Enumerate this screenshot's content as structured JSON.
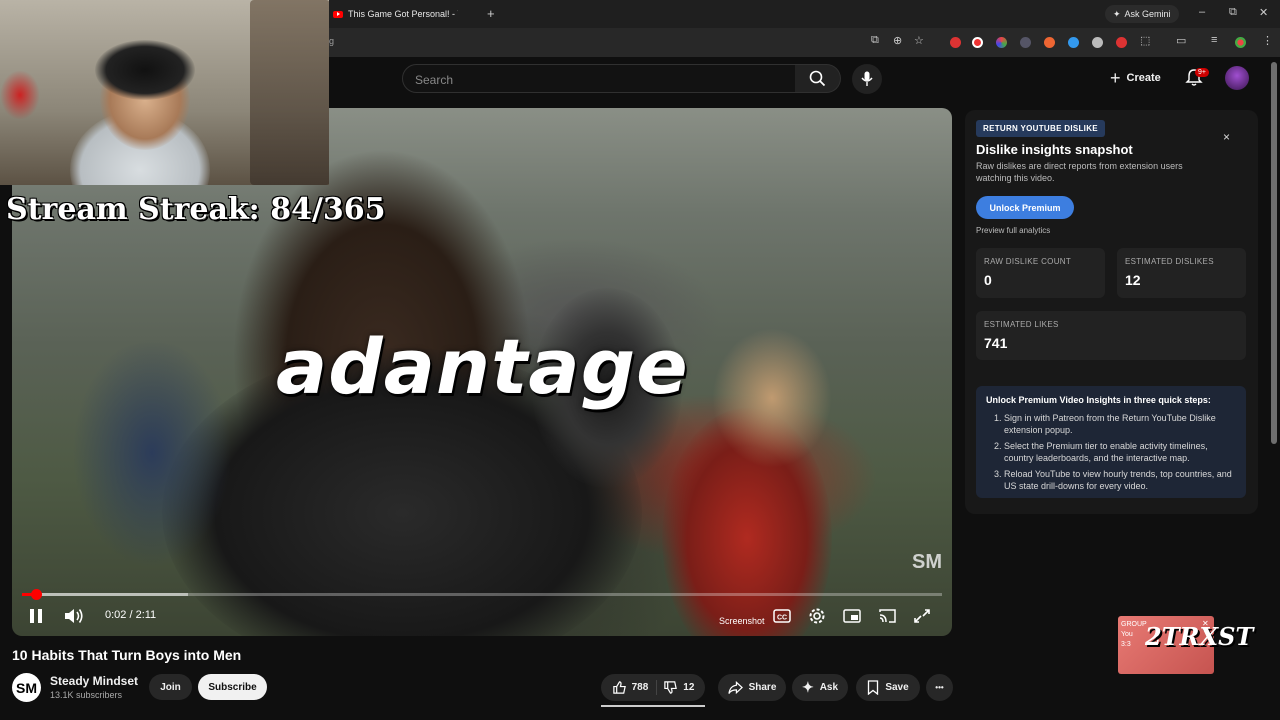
{
  "browser": {
    "tab_title": "This Game Got Personal! - YouTube",
    "url": "g",
    "ask_gemini": "Ask Gemini",
    "new_tab_symbol": "+",
    "minimize_symbol": "–",
    "restore_symbol": "⧉",
    "close_symbol": "✕"
  },
  "header": {
    "search_placeholder": "Search",
    "create_label": "Create",
    "notification_count": "9+"
  },
  "player": {
    "overlay_caption": "adantage",
    "watermark": "SM",
    "time_display": "0:02 / 2:11",
    "played_fraction": 0.015,
    "buffered_fraction": 0.18,
    "screenshot_label": "Screenshot"
  },
  "stream": {
    "streak_text": "Stream Streak: 84/365"
  },
  "panel": {
    "badge": "RETURN YOUTUBE DISLIKE",
    "title": "Dislike insights snapshot",
    "description": "Raw dislikes are direct reports from extension users watching this video.",
    "unlock_label": "Unlock Premium",
    "preview_label": "Preview full analytics",
    "close_symbol": "×",
    "stats": [
      {
        "label": "RAW DISLIKE COUNT",
        "value": "0"
      },
      {
        "label": "ESTIMATED DISLIKES",
        "value": "12"
      },
      {
        "label": "ESTIMATED LIKES",
        "value": "741"
      }
    ],
    "steps_title": "Unlock Premium Video Insights in three quick steps:",
    "steps": [
      "Sign in with Patreon from the Return YouTube Dislike extension popup.",
      "Select the Premium tier to enable activity timelines, country leaderboards, and the interactive map.",
      "Reload YouTube to view hourly trends, top countries, and US state drill-downs for every video."
    ]
  },
  "video": {
    "title": "10 Habits That Turn Boys into Men",
    "channel_name": "Steady Mindset",
    "channel_initials": "SM",
    "subscribers": "13.1K subscribers",
    "join_label": "Join",
    "subscribe_label": "Subscribe",
    "likes": "788",
    "dislikes": "12",
    "share_label": "Share",
    "ask_label": "Ask",
    "save_label": "Save",
    "more_symbol": "•••"
  },
  "sticker": {
    "brand": "2TRXST",
    "small_text": "GROUP\nYou\n3:3"
  },
  "colors": {
    "accent_red": "#ff0000",
    "premium_blue": "#3d7ee0",
    "panel_badge": "#263a5c"
  }
}
